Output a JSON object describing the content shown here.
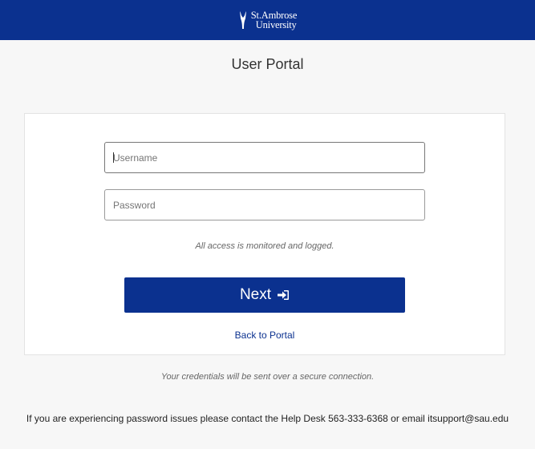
{
  "header": {
    "logo_line1": "St.Ambrose",
    "logo_line2": "University",
    "background_color": "#0b318f",
    "logo_icon": "torch-icon"
  },
  "page_title": "User Portal",
  "login_form": {
    "username_placeholder": "Username",
    "username_value": "",
    "password_placeholder": "Password",
    "password_value": "",
    "notice": "All access is monitored and logged.",
    "next_label": "Next",
    "next_icon": "sign-in-icon",
    "back_link": "Back to Portal"
  },
  "footer": {
    "secure_note": "Your credentials will be sent over a secure connection.",
    "help_text": "If you are experiencing password issues please contact the Help Desk 563-333-6368 or email itsupport@sau.edu"
  },
  "colors": {
    "accent": "#0b318f",
    "page_background": "#f7f7f7"
  }
}
